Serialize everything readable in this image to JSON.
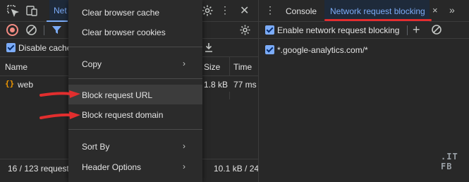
{
  "left_panel": {
    "tab_label": "Net",
    "options": {
      "disable_cache_label": "Disable cache"
    },
    "columns": {
      "name": "Name",
      "size": "Size",
      "time": "Time"
    },
    "rows": [
      {
        "icon": "{}",
        "name": "web",
        "size": "1.8 kB",
        "time": "77 ms"
      }
    ],
    "status": {
      "requests": "16 / 123 request",
      "transferred": "10.1 kB / 24,"
    }
  },
  "context_menu": {
    "items": [
      {
        "label": "Clear browser cache"
      },
      {
        "label": "Clear browser cookies"
      },
      {
        "label": "Copy",
        "submenu_arrow": "›"
      },
      {
        "label": "Block request URL"
      },
      {
        "label": "Block request domain"
      },
      {
        "label": "Sort By",
        "submenu_arrow": "›"
      },
      {
        "label": "Header Options",
        "submenu_arrow": "›"
      }
    ]
  },
  "drawer": {
    "more_icon": "⋮",
    "tabs": [
      {
        "label": "Console"
      },
      {
        "label": "Network request blocking",
        "close": "×"
      }
    ],
    "overflow_icon": "»",
    "enable_label": "Enable network request blocking",
    "add_icon": "+",
    "patterns": [
      {
        "label": "*.google-analytics.com/*",
        "checked": true
      }
    ]
  },
  "watermark": {
    "line1": ".IT",
    "line2": "FB"
  },
  "colors": {
    "accent": "#7cacf8",
    "annotation_red": "#e22e2e",
    "record": "#f28b82",
    "background": "#282828"
  }
}
